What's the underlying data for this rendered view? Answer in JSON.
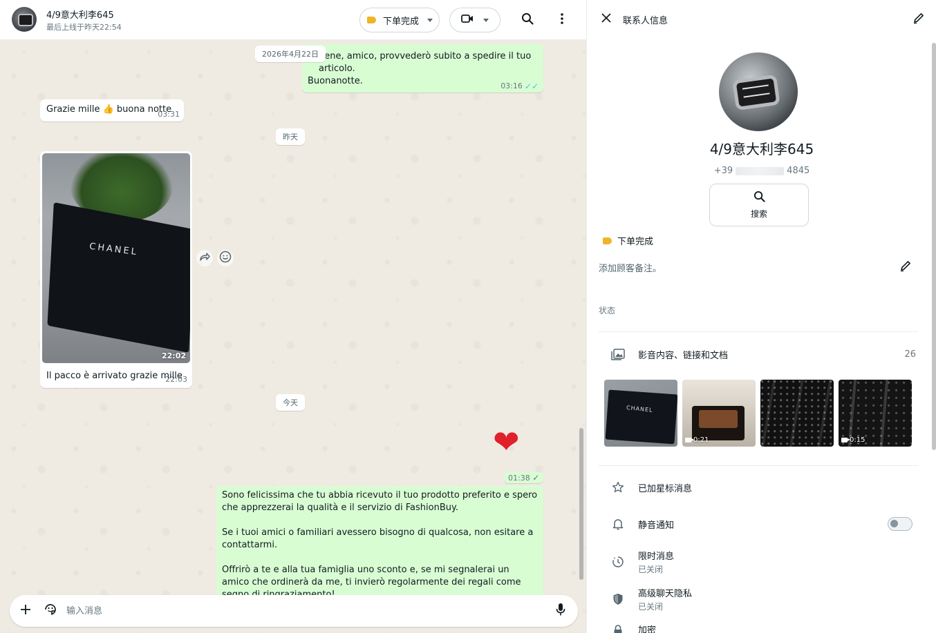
{
  "chat": {
    "header": {
      "name": "4/9意大利李645",
      "last_seen": "最后上线于昨天22:54",
      "label": "下单完成"
    },
    "dates": {
      "d1": "2026年4月22日",
      "d2": "昨天",
      "d3": "今天"
    },
    "messages": {
      "m1_line1": "bene, amico, provvederò subito a spedire il tuo articolo.",
      "m1_line2": "Buonanotte.",
      "m1_time": "03:16",
      "m2_text_a": "Grazie mille",
      "m2_emoji": "👍",
      "m2_text_b": "buona notte",
      "m2_time": "03:31",
      "img_time": "22:02",
      "img_box_label": "CHANEL",
      "img_caption": "Il pacco è arrivato grazie mille",
      "img_caption_time": "22:03",
      "heart": "❤",
      "heart_time": "01:38",
      "m4_p1": "Sono felicissima che tu abbia ricevuto il tuo prodotto preferito e spero che apprezzerai la qualità e il servizio di FashionBuy.",
      "m4_p2": "Se i tuoi amici o familiari avessero bisogno di qualcosa, non esitare a contattarmi.",
      "m4_p3": "Offrirò a te e alla tua famiglia uno sconto e, se mi segnalerai un amico che ordinerà da me, ti invierò regolarmente dei regali come segno di ringraziamento!",
      "m4_emojis": "🥰❤️"
    },
    "composer": {
      "placeholder": "输入消息"
    }
  },
  "panel": {
    "title": "联系人信息",
    "name": "4/9意大利李645",
    "phone_prefix": "+39",
    "phone_suffix": "4845",
    "search_label": "搜索",
    "label": "下单完成",
    "note_placeholder": "添加顾客备注。",
    "status_label": "状态",
    "media_label": "影音内容、链接和文档",
    "media_count": "26",
    "thumb1_label": "CHANEL",
    "thumb2_duration": "0:21",
    "thumb4_duration": "0:15",
    "starred": "已加星标消息",
    "mute": "静音通知",
    "disappearing_title": "限时消息",
    "disappearing_sub": "已关闭",
    "privacy_title": "高级聊天隐私",
    "privacy_sub": "已关闭",
    "encryption_title": "加密"
  },
  "colors": {
    "outgoing_bubble": "#d9fdd3",
    "incoming_bubble": "#ffffff",
    "chat_background": "#efeae2",
    "label_tag": "#f0b429",
    "read_ticks": "#53bdeb"
  },
  "icons": [
    "search-icon",
    "menu-icon",
    "video-icon",
    "close-icon",
    "pencil-icon",
    "plus-icon",
    "sticker-icon",
    "mic-icon",
    "forward-icon",
    "emoji-icon",
    "media-icon",
    "star-icon",
    "bell-icon",
    "timer-icon",
    "shield-icon",
    "lock-icon",
    "tag-icon"
  ]
}
